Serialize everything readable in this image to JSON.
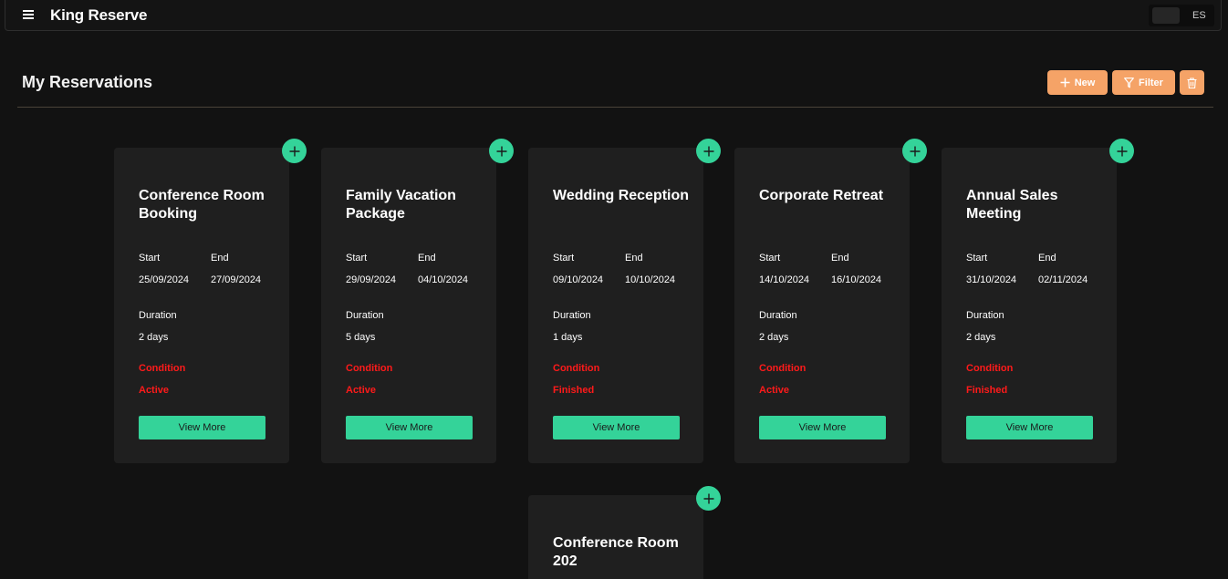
{
  "header": {
    "app_title": "King Reserve",
    "lang_label": "ES"
  },
  "main": {
    "page_title": "My Reservations",
    "actions": {
      "new_label": "New",
      "filter_label": "Filter"
    }
  },
  "labels": {
    "start": "Start",
    "end": "End",
    "duration": "Duration",
    "condition": "Condition",
    "view_more": "View More"
  },
  "reservations": [
    {
      "title": "Conference Room Booking",
      "start": "25/09/2024",
      "end": "27/09/2024",
      "duration": "2 days",
      "condition": "Active"
    },
    {
      "title": "Family Vacation Package",
      "start": "29/09/2024",
      "end": "04/10/2024",
      "duration": "5 days",
      "condition": "Active"
    },
    {
      "title": "Wedding Reception",
      "start": "09/10/2024",
      "end": "10/10/2024",
      "duration": "1 days",
      "condition": "Finished"
    },
    {
      "title": "Corporate Retreat",
      "start": "14/10/2024",
      "end": "16/10/2024",
      "duration": "2 days",
      "condition": "Active"
    },
    {
      "title": "Annual Sales Meeting",
      "start": "31/10/2024",
      "end": "02/11/2024",
      "duration": "2 days",
      "condition": "Finished"
    },
    {
      "title": "Conference Room 202"
    }
  ],
  "colors": {
    "accent_orange": "#f5a367",
    "accent_green": "#34d399",
    "condition_red": "#ff1a1a",
    "background": "#121212",
    "card": "#1f1f1f"
  }
}
